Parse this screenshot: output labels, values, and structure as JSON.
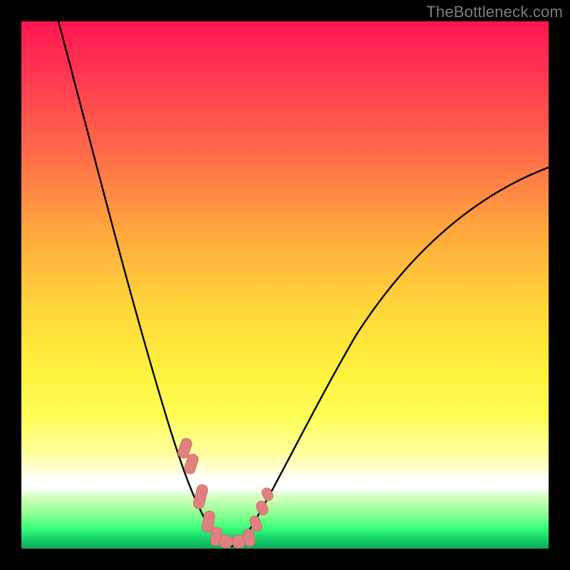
{
  "watermark": "TheBottleneck.com",
  "colors": {
    "frame": "#000000",
    "curve_stroke": "#000000",
    "marker_fill": "#e08080",
    "marker_stroke": "#d46a6a"
  },
  "chart_data": {
    "type": "line",
    "title": "",
    "xlabel": "",
    "ylabel": "",
    "xlim": [
      0,
      100
    ],
    "ylim": [
      0,
      100
    ],
    "note": "Stylized bottleneck curve — a steep V with minimum near x≈35–40 reaching y≈0; left branch starts near (7,100), right branch ends near (100,72). Gradient background encodes percent bottleneck: top=red≈100%, white band≈12%, bottom=green≈0%.",
    "series": [
      {
        "name": "bottleneck-curve",
        "x": [
          7,
          12,
          16,
          20,
          24,
          27,
          30,
          32,
          34,
          36,
          38,
          40,
          42,
          44,
          47,
          52,
          58,
          66,
          75,
          85,
          95,
          100
        ],
        "y": [
          100,
          84,
          70,
          56,
          43,
          32,
          22,
          14,
          7,
          2,
          0,
          0,
          1,
          3,
          8,
          16,
          26,
          38,
          50,
          60,
          68,
          72
        ]
      }
    ],
    "markers": {
      "name": "highlighted-points-near-minimum",
      "x": [
        30.5,
        31.5,
        33.0,
        34.0,
        35.0,
        36.5,
        38.0,
        39.5,
        41.0,
        42.0,
        43.0,
        43.8
      ],
      "y": [
        20,
        17,
        10,
        6,
        3,
        1,
        0,
        0,
        1,
        3,
        7,
        11
      ]
    },
    "gradient_scale": {
      "orientation": "vertical",
      "stops_percent_to_color": [
        {
          "pct": 0,
          "color": "#0fa85d"
        },
        {
          "pct": 6,
          "color": "#3cff7a"
        },
        {
          "pct": 12,
          "color": "#ffffff"
        },
        {
          "pct": 25,
          "color": "#ffff58"
        },
        {
          "pct": 45,
          "color": "#ffd83a"
        },
        {
          "pct": 70,
          "color": "#ff6b4a"
        },
        {
          "pct": 100,
          "color": "#ff1650"
        }
      ]
    }
  }
}
